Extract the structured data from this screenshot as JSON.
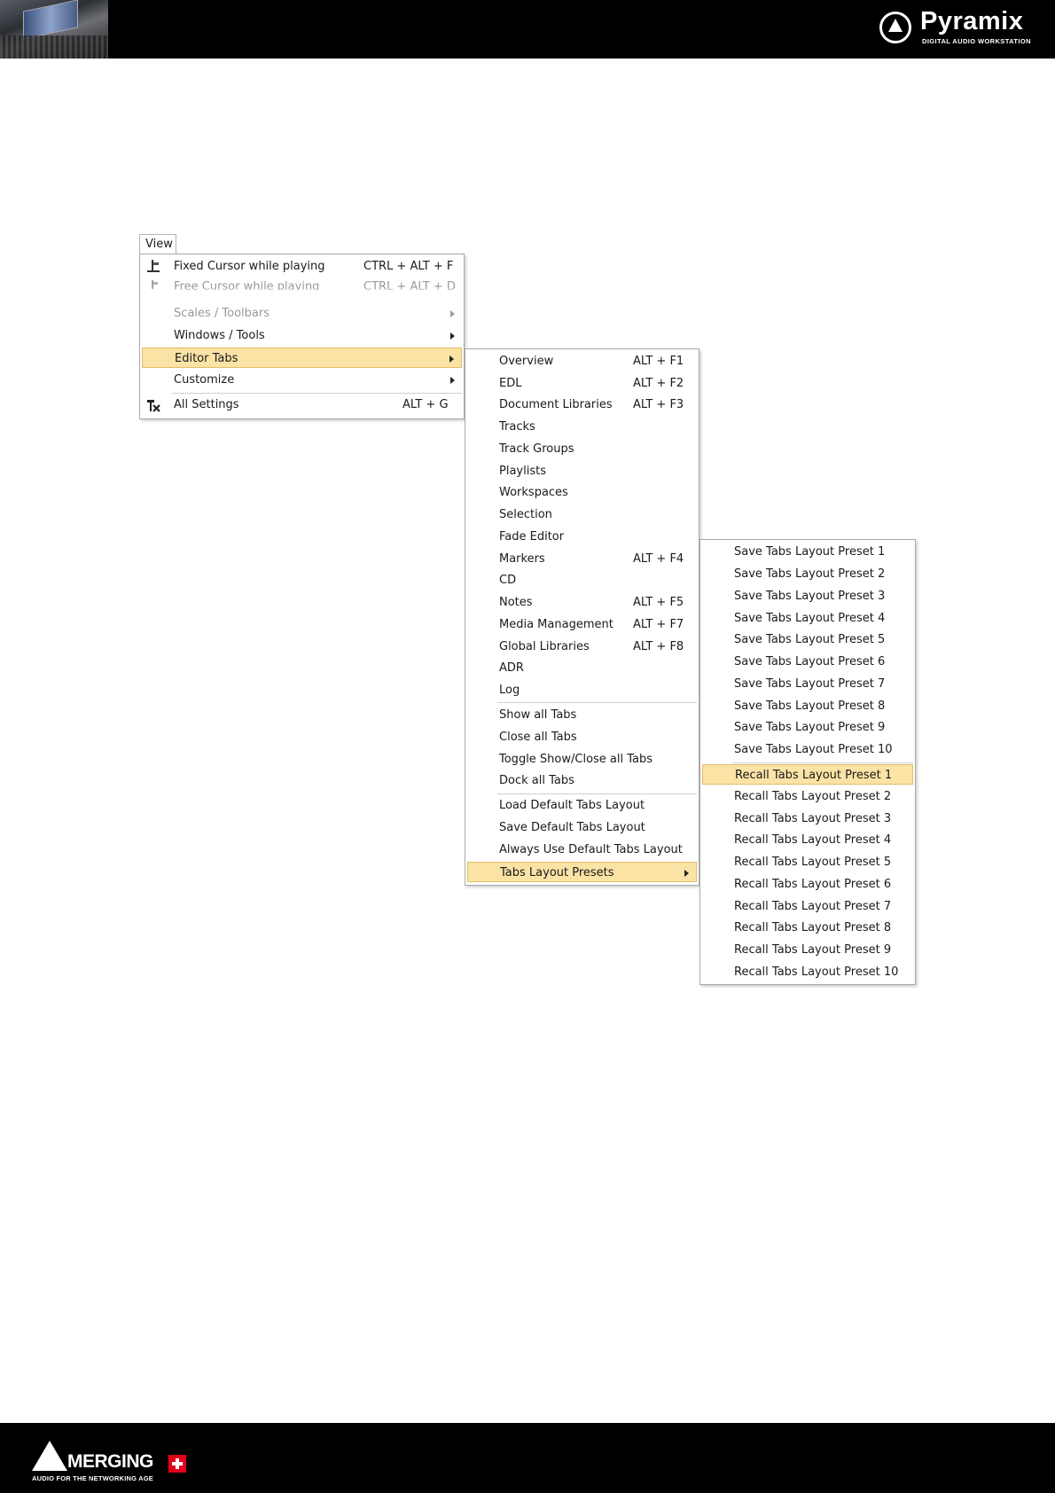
{
  "header": {
    "brand_name": "Pyramix",
    "brand_sub": "DIGITAL AUDIO WORKSTATION"
  },
  "footer": {
    "brand_name": "MERGING",
    "tagline": "AUDIO FOR THE NETWORKING AGE"
  },
  "view_menu": {
    "title": "View",
    "items": [
      {
        "label": "Fixed Cursor while playing",
        "shortcut": "CTRL + ALT + F",
        "icon": "fixed-cursor-icon"
      },
      {
        "label": "Free Cursor while playing",
        "shortcut": "CTRL + ALT + D",
        "icon": "free-cursor-icon"
      },
      {
        "label": "Scales / Toolbars",
        "shortcut": ""
      },
      {
        "label": "Windows / Tools",
        "shortcut": ""
      },
      {
        "label": "Editor Tabs",
        "shortcut": ""
      },
      {
        "label": "Customize",
        "shortcut": ""
      },
      {
        "label": "All Settings",
        "shortcut": "ALT + G",
        "icon": "settings-tools-icon"
      }
    ]
  },
  "editor_tabs_menu": {
    "items": [
      {
        "label": "Overview",
        "shortcut": "ALT + F1"
      },
      {
        "label": "EDL",
        "shortcut": "ALT + F2"
      },
      {
        "label": "Document Libraries",
        "shortcut": "ALT + F3"
      },
      {
        "label": "Tracks",
        "shortcut": ""
      },
      {
        "label": "Track Groups",
        "shortcut": ""
      },
      {
        "label": "Playlists",
        "shortcut": ""
      },
      {
        "label": "Workspaces",
        "shortcut": ""
      },
      {
        "label": "Selection",
        "shortcut": ""
      },
      {
        "label": "Fade Editor",
        "shortcut": ""
      },
      {
        "label": "Markers",
        "shortcut": "ALT + F4"
      },
      {
        "label": "CD",
        "shortcut": ""
      },
      {
        "label": "Notes",
        "shortcut": "ALT + F5"
      },
      {
        "label": "Media Management",
        "shortcut": "ALT + F7"
      },
      {
        "label": "Global Libraries",
        "shortcut": "ALT + F8"
      },
      {
        "label": "ADR",
        "shortcut": ""
      },
      {
        "label": "Log",
        "shortcut": ""
      },
      {
        "label": "Show all Tabs",
        "shortcut": ""
      },
      {
        "label": "Close all Tabs",
        "shortcut": ""
      },
      {
        "label": "Toggle Show/Close all Tabs",
        "shortcut": ""
      },
      {
        "label": "Dock all Tabs",
        "shortcut": ""
      },
      {
        "label": "Load Default Tabs Layout",
        "shortcut": ""
      },
      {
        "label": "Save Default Tabs Layout",
        "shortcut": ""
      },
      {
        "label": "Always Use Default Tabs Layout",
        "shortcut": ""
      },
      {
        "label": "Tabs Layout Presets",
        "shortcut": ""
      }
    ]
  },
  "presets_menu": {
    "items": [
      "Save Tabs Layout Preset 1",
      "Save Tabs Layout Preset 2",
      "Save Tabs Layout Preset 3",
      "Save Tabs Layout Preset 4",
      "Save Tabs Layout Preset 5",
      "Save Tabs Layout Preset 6",
      "Save Tabs Layout Preset 7",
      "Save Tabs Layout Preset 8",
      "Save Tabs Layout Preset 9",
      "Save Tabs Layout Preset 10",
      "Recall Tabs Layout Preset 1",
      "Recall Tabs Layout Preset 2",
      "Recall Tabs Layout Preset 3",
      "Recall Tabs Layout Preset 4",
      "Recall Tabs Layout Preset 5",
      "Recall Tabs Layout Preset 6",
      "Recall Tabs Layout Preset 7",
      "Recall Tabs Layout Preset 8",
      "Recall Tabs Layout Preset 9",
      "Recall Tabs Layout Preset 10"
    ]
  },
  "colors": {
    "highlight": "#fbe3a6",
    "highlight_border": "#e2bd66",
    "bar": "#000000"
  }
}
